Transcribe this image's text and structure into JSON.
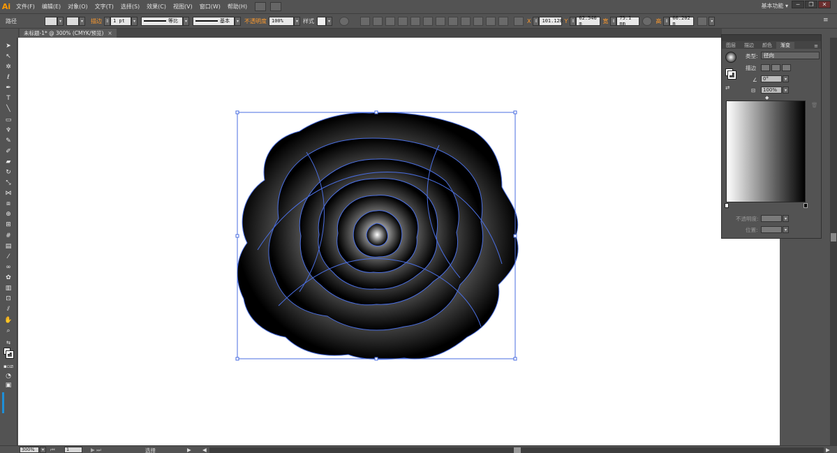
{
  "app": {
    "logo": "Ai",
    "workspace": "基本功能"
  },
  "menu": [
    "文件(F)",
    "编辑(E)",
    "对象(O)",
    "文字(T)",
    "选择(S)",
    "效果(C)",
    "视图(V)",
    "窗口(W)",
    "帮助(H)"
  ],
  "control": {
    "label_path": "路径",
    "stroke_label": "描边",
    "stroke_weight": "1 pt",
    "stroke_profile": "等比",
    "brush": "基本",
    "opacity_label": "不透明度",
    "opacity_value": "100%",
    "style_label": "样式",
    "x_label": "X",
    "x_value": "101.128",
    "y_label": "Y",
    "y_value": "62.546 m",
    "w_label": "宽",
    "w_value": "75.1 mm",
    "h_label": "高",
    "h_value": "66.202 m"
  },
  "document_tab": {
    "title": "未标题-1* @ 300% (CMYK/预览)",
    "close": "×"
  },
  "gradient_panel": {
    "tabs": [
      "图层",
      "描边",
      "颜色",
      "渐变"
    ],
    "active_tab": "渐变",
    "type_label": "类型:",
    "type_value": "径向",
    "stroke_label": "描边",
    "angle_value": "0°",
    "aspect_value": "100%",
    "opacity_label": "不透明度:",
    "position_label": "位置:"
  },
  "status": {
    "zoom": "300%",
    "artboard": "1",
    "tool_name": "选择"
  },
  "colors": {
    "accent": "#ff9b2e",
    "selection": "#4a6ee0"
  }
}
